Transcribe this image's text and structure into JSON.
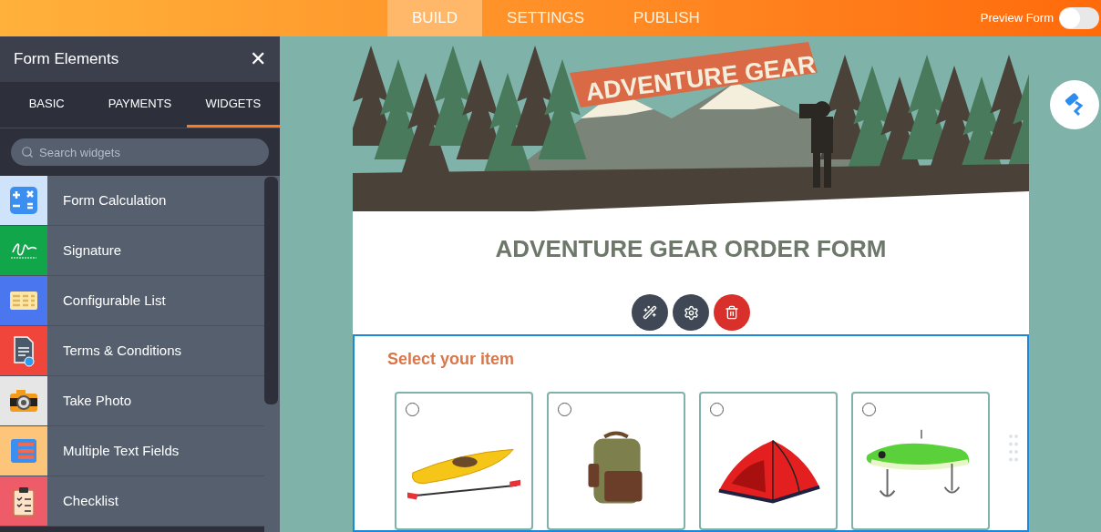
{
  "topbar": {
    "tabs": [
      {
        "label": "BUILD",
        "selected": true
      },
      {
        "label": "SETTINGS",
        "selected": false
      },
      {
        "label": "PUBLISH",
        "selected": false
      }
    ],
    "preview": {
      "label": "Preview Form",
      "on": false
    }
  },
  "sidebar": {
    "title": "Form Elements",
    "close": "✕",
    "tabs": [
      {
        "label": "BASIC",
        "selected": false
      },
      {
        "label": "PAYMENTS",
        "selected": false
      },
      {
        "label": "WIDGETS",
        "selected": true
      }
    ],
    "search": {
      "placeholder": "Search widgets"
    },
    "items": [
      {
        "label": "Form Calculation",
        "kind": "calculator",
        "color": "#cfe3fb"
      },
      {
        "label": "Signature",
        "kind": "signature",
        "color": "#12a64a"
      },
      {
        "label": "Configurable List",
        "kind": "list",
        "color": "#4a76f0"
      },
      {
        "label": "Terms & Conditions",
        "kind": "document",
        "color": "#f0453a"
      },
      {
        "label": "Take Photo",
        "kind": "camera",
        "color": "#e6e6e6"
      },
      {
        "label": "Multiple Text Fields",
        "kind": "fields",
        "color": "#fcc57a"
      },
      {
        "label": "Checklist",
        "kind": "clipboard",
        "color": "#ee5c6a"
      }
    ]
  },
  "form": {
    "banner_text": "ADVENTURE GEAR",
    "title": "ADVENTURE GEAR ORDER FORM",
    "question": {
      "label": "Select your item",
      "options": [
        {
          "kind": "kayak",
          "selected": false
        },
        {
          "kind": "backpack",
          "selected": false
        },
        {
          "kind": "tent",
          "selected": false
        },
        {
          "kind": "lure",
          "selected": false
        }
      ]
    }
  }
}
